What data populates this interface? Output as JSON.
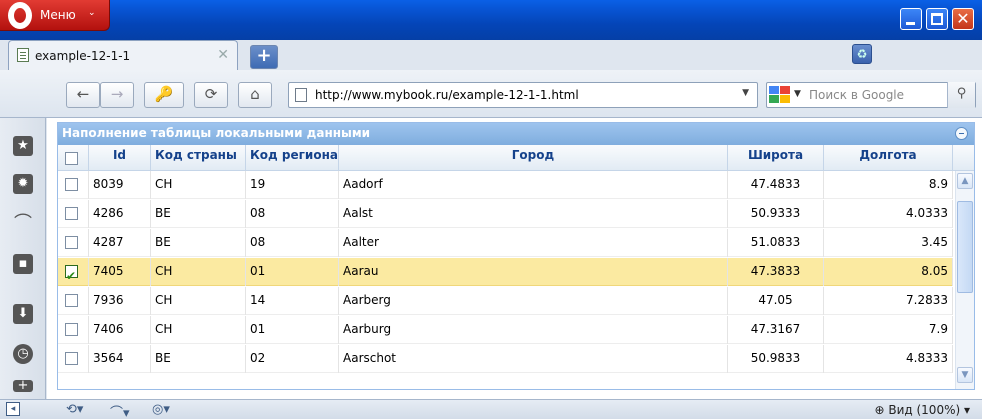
{
  "window": {
    "menu_label": "Меню",
    "menu_arrow": "⌄"
  },
  "tabs": [
    {
      "title": "example-12-1-1",
      "close": "✕"
    }
  ],
  "newtab_symbol": "+",
  "toolbar": {
    "back": "←",
    "forward": "→",
    "keys": "🔑",
    "reload": "⟳",
    "home": "⌂",
    "address": "http://www.mybook.ru/example-12-1-1.html",
    "address_drop": "▼",
    "search_placeholder": "Поиск в Google",
    "search_go": "⚲"
  },
  "grid": {
    "title": "Наполнение таблицы локальными данными",
    "columns": [
      "Id",
      "Код страны",
      "Код региона",
      "Город",
      "Широта",
      "Долгота"
    ],
    "rows": [
      {
        "checked": false,
        "id": "8039",
        "country": "CH",
        "region": "19",
        "city": "Aadorf",
        "lat": "47.4833",
        "lon": "8.9"
      },
      {
        "checked": false,
        "id": "4286",
        "country": "BE",
        "region": "08",
        "city": "Aalst",
        "lat": "50.9333",
        "lon": "4.0333"
      },
      {
        "checked": false,
        "id": "4287",
        "country": "BE",
        "region": "08",
        "city": "Aalter",
        "lat": "51.0833",
        "lon": "3.45"
      },
      {
        "checked": true,
        "id": "7405",
        "country": "CH",
        "region": "01",
        "city": "Aarau",
        "lat": "47.3833",
        "lon": "8.05"
      },
      {
        "checked": false,
        "id": "7936",
        "country": "CH",
        "region": "14",
        "city": "Aarberg",
        "lat": "47.05",
        "lon": "7.2833"
      },
      {
        "checked": false,
        "id": "7406",
        "country": "CH",
        "region": "01",
        "city": "Aarburg",
        "lat": "47.3167",
        "lon": "7.9"
      },
      {
        "checked": false,
        "id": "3564",
        "country": "BE",
        "region": "02",
        "city": "Aarschot",
        "lat": "50.9833",
        "lon": "4.8333"
      }
    ]
  },
  "statusbar": {
    "zoom": "Вид (100%)"
  },
  "colors": {
    "selected_row": "#fbeaa1",
    "header_text": "#15428b",
    "title_bar": "#0856d6"
  }
}
